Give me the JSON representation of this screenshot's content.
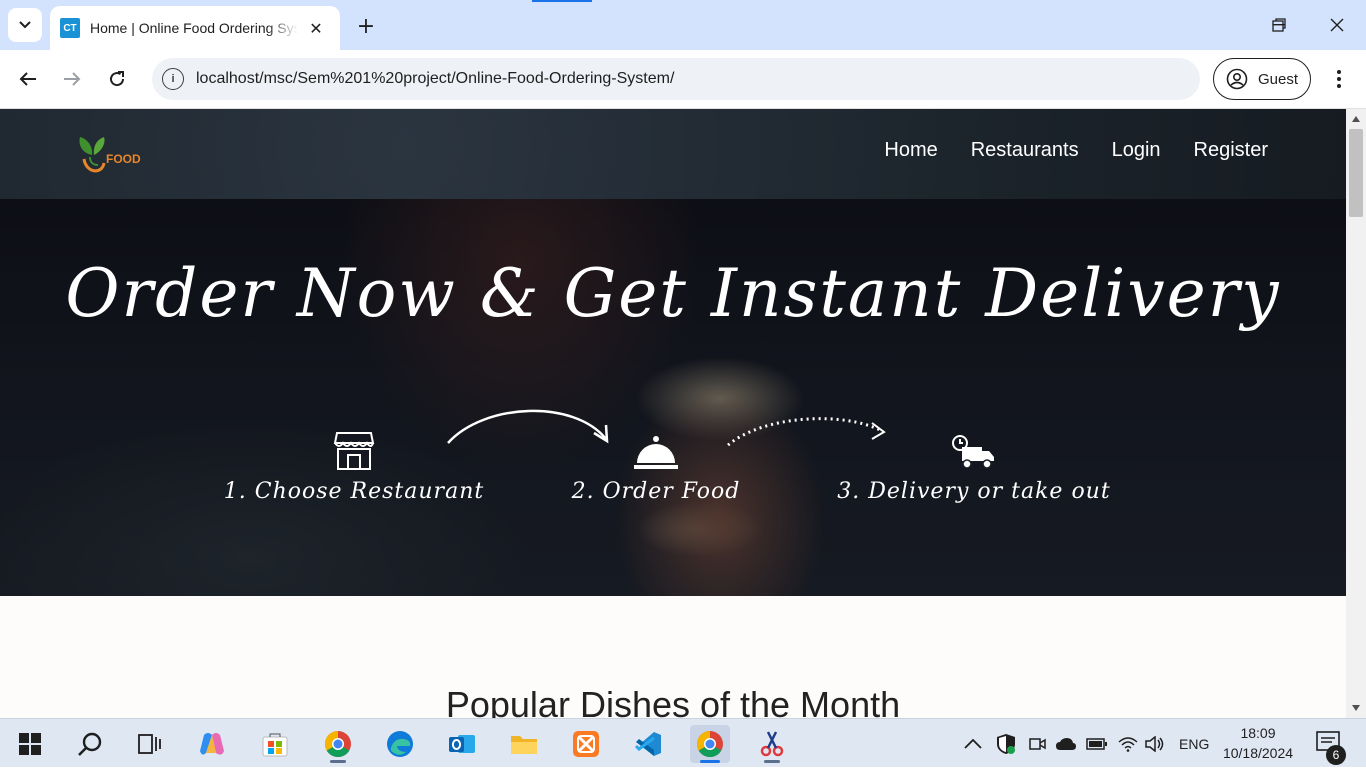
{
  "browser": {
    "tab": {
      "favicon_text": "CT",
      "title": "Home | Online Food Ordering System",
      "close": "✕"
    },
    "new_tab": "+",
    "window_controls": {
      "minimize": "—",
      "maximize": "❐",
      "close": "✕"
    },
    "url": "localhost/msc/Sem%201%20project/Online-Food-Ordering-System/",
    "site_info_icon": "i",
    "profile_label": "Guest",
    "icons": {
      "tab_search": "chevron-down-icon",
      "back": "arrow-left-icon",
      "forward": "arrow-right-icon",
      "reload": "reload-icon",
      "menu": "three-dots-icon"
    }
  },
  "site": {
    "logo_text": "FOOD",
    "nav": [
      "Home",
      "Restaurants",
      "Login",
      "Register"
    ],
    "hero": {
      "title": "Order Now & Get Instant Delivery",
      "steps": [
        {
          "label": "1. Choose Restaurant",
          "icon": "store-icon"
        },
        {
          "label": "2. Order Food",
          "icon": "cloche-icon"
        },
        {
          "label": "3. Delivery or take out",
          "icon": "delivery-truck-icon"
        }
      ]
    },
    "section_heading": "Popular Dishes of the Month"
  },
  "taskbar": {
    "apps": [
      "start-icon",
      "search-icon",
      "task-view-icon",
      "copilot-icon",
      "store-icon",
      "chrome-icon",
      "edge-icon",
      "outlook-icon",
      "file-explorer-icon",
      "xampp-icon",
      "vscode-icon",
      "chrome-icon",
      "snipping-tool-icon"
    ],
    "language": "ENG",
    "time": "18:09",
    "date": "10/18/2024",
    "notification_count": "6"
  },
  "colors": {
    "tabstrip": "#d3e3fd",
    "nav_bg": "#1d252d",
    "accent_green": "#3f8f2e",
    "accent_orange": "#e8862a"
  }
}
